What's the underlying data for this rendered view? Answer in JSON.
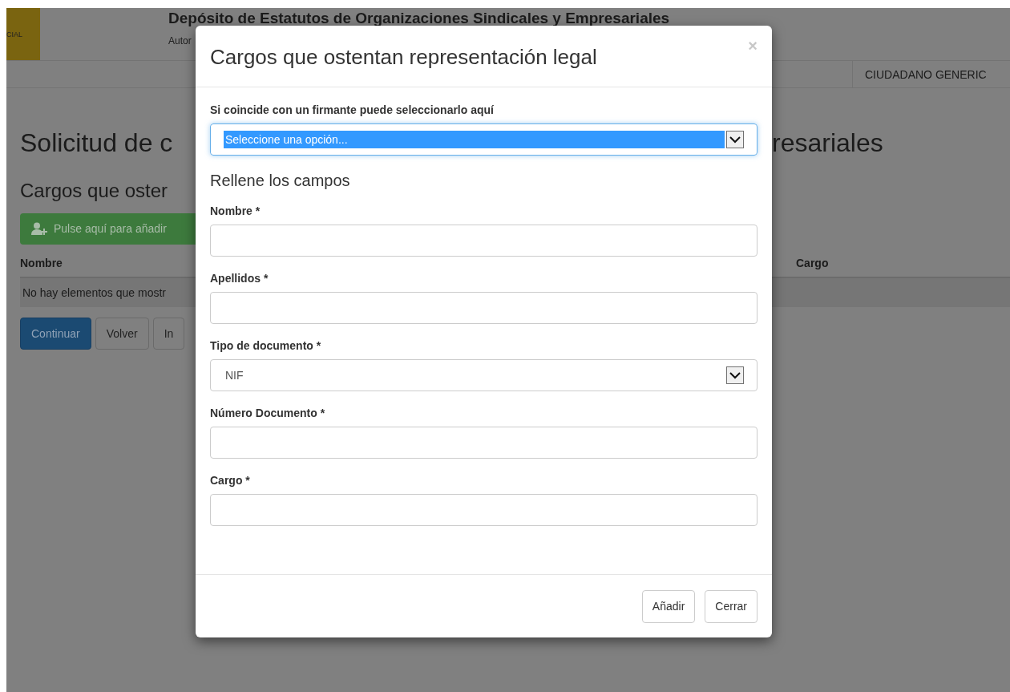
{
  "header": {
    "logo_text": "CIAL",
    "title": "Depósito de Estatutos de Organizaciones Sindicales y Empresariales",
    "subtitle": "Autor"
  },
  "nav": {
    "user": "CIUDADANO GENERIC"
  },
  "page": {
    "heading_left": "Solicitud de c",
    "heading_right": "resariales",
    "subheading": "Cargos que oster",
    "add_button": "Pulse aquí para añadir",
    "table": {
      "columns_left": [
        "Nombre"
      ],
      "columns_right": [
        "Cargo"
      ],
      "empty_message": "No hay elementos que mostr"
    },
    "buttons": [
      {
        "label": "Continuar",
        "kind": "primary"
      },
      {
        "label": "Volver",
        "kind": "default"
      },
      {
        "label": "In",
        "kind": "default"
      }
    ]
  },
  "modal": {
    "title": "Cargos que ostentan representación legal",
    "close": "×",
    "signer_select": {
      "label": "Si coincide con un firmante puede seleccionarlo aquí",
      "value": "Seleccione una opción...",
      "focused": true
    },
    "section_title": "Rellene los campos",
    "fields": [
      {
        "label": "Nombre *",
        "kind": "text"
      },
      {
        "label": "Apellidos *",
        "kind": "text"
      },
      {
        "label": "Tipo de documento *",
        "kind": "select",
        "value": "NIF"
      },
      {
        "label": "Número Documento *",
        "kind": "text"
      },
      {
        "label": "Cargo *",
        "kind": "text"
      }
    ],
    "buttons": [
      "Añadir",
      "Cerrar"
    ]
  }
}
